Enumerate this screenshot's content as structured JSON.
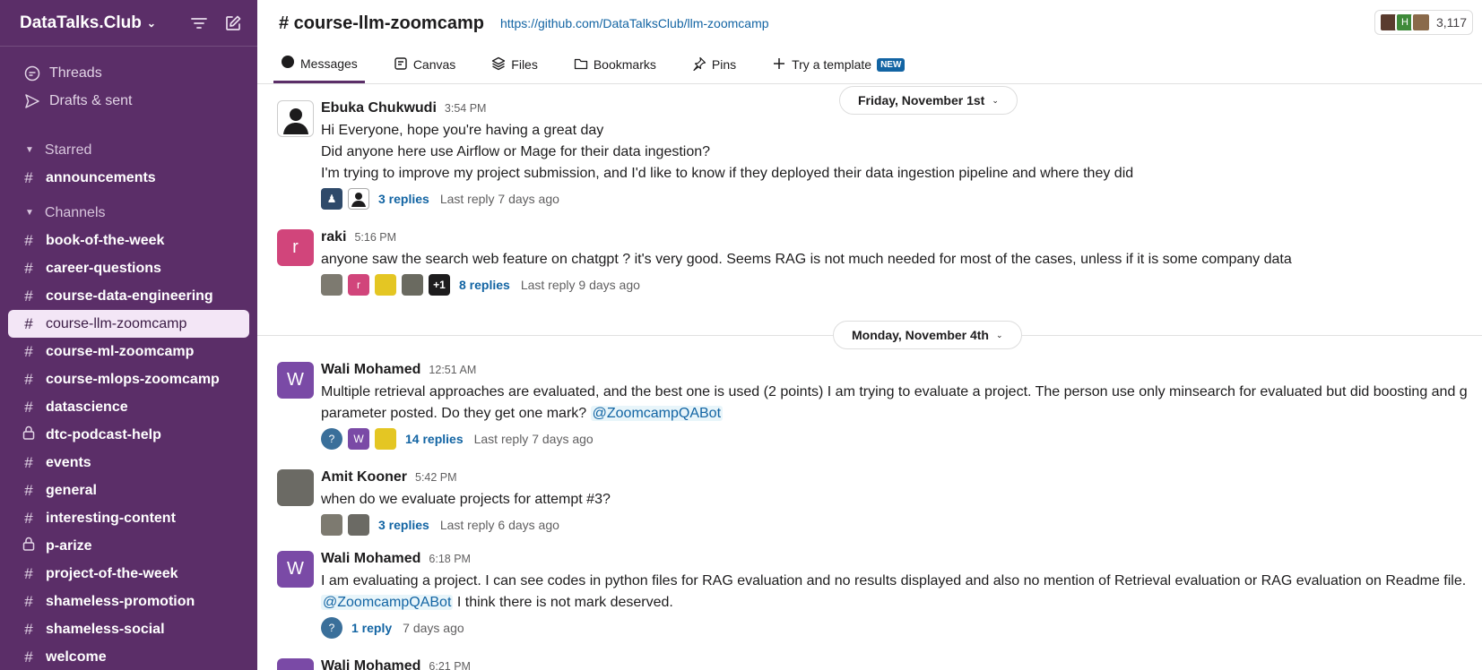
{
  "workspace": {
    "name": "DataTalks.Club"
  },
  "nav": [
    {
      "label": "Threads",
      "icon": "threads-icon"
    },
    {
      "label": "Drafts & sent",
      "icon": "send-icon"
    }
  ],
  "starred": {
    "header": "Starred",
    "channels": [
      "announcements"
    ]
  },
  "channels": {
    "header": "Channels",
    "items": [
      {
        "name": "book-of-the-week",
        "private": false
      },
      {
        "name": "career-questions",
        "private": false
      },
      {
        "name": "course-data-engineering",
        "private": false
      },
      {
        "name": "course-llm-zoomcamp",
        "private": false,
        "active": true
      },
      {
        "name": "course-ml-zoomcamp",
        "private": false
      },
      {
        "name": "course-mlops-zoomcamp",
        "private": false
      },
      {
        "name": "datascience",
        "private": false
      },
      {
        "name": "dtc-podcast-help",
        "private": true
      },
      {
        "name": "events",
        "private": false
      },
      {
        "name": "general",
        "private": false
      },
      {
        "name": "interesting-content",
        "private": false
      },
      {
        "name": "p-arize",
        "private": true
      },
      {
        "name": "project-of-the-week",
        "private": false
      },
      {
        "name": "shameless-promotion",
        "private": false
      },
      {
        "name": "shameless-social",
        "private": false
      },
      {
        "name": "welcome",
        "private": false
      }
    ]
  },
  "header": {
    "title": "# course-llm-zoomcamp",
    "topic": "https://github.com/DataTalksClub/llm-zoomcamp",
    "member_count": "3,117"
  },
  "tabs": [
    {
      "label": "Messages",
      "icon": "message-icon"
    },
    {
      "label": "Canvas",
      "icon": "canvas-icon"
    },
    {
      "label": "Files",
      "icon": "files-icon"
    },
    {
      "label": "Bookmarks",
      "icon": "bookmark-icon"
    },
    {
      "label": "Pins",
      "icon": "pin-icon"
    },
    {
      "label": "Try a template",
      "icon": "plus-icon",
      "badge": "NEW"
    }
  ],
  "dates": [
    "Friday, November 1st",
    "Monday, November 4th"
  ],
  "messages": [
    {
      "author": "Ebuka Chukwudi",
      "time": "3:54 PM",
      "lines": [
        "Hi Everyone, hope you're having a great day",
        "Did anyone here use Airflow or Mage for their data ingestion?",
        "I'm trying to improve my project submission, and I'd like to know if they deployed their data ingestion pipeline and where they did"
      ],
      "replies": "3 replies",
      "last_reply": "Last reply 7 days ago"
    },
    {
      "author": "raki",
      "time": "5:16 PM",
      "lines": [
        "anyone saw the search web feature on chatgpt ? it's very good. Seems RAG is not much needed for most of the cases, unless if it is some company data"
      ],
      "avatar_letter": "r",
      "plus_count": "+1",
      "replies": "8 replies",
      "last_reply": "Last reply 9 days ago"
    },
    {
      "author": "Wali Mohamed",
      "time": "12:51 AM",
      "lines": [
        "Multiple retrieval approaches are evaluated, and the best one is used (2 points)  I am trying to evaluate a project. The person use only minsearch for evaluated but did boosting and g",
        "parameter posted. Do they get one mark?"
      ],
      "mention": "@ZoomcampQABot",
      "avatar_letter": "W",
      "replies": "14 replies",
      "last_reply": "Last reply 7 days ago"
    },
    {
      "author": "Amit Kooner",
      "time": "5:42 PM",
      "lines": [
        "when do we evaluate projects for attempt #3?"
      ],
      "replies": "3 replies",
      "last_reply": "Last reply 6 days ago"
    },
    {
      "author": "Wali Mohamed",
      "time": "6:18 PM",
      "lines": [
        "I am evaluating a project. I can see codes in python files for RAG evaluation and no results displayed and also no mention of Retrieval evaluation or RAG evaluation on Readme file.",
        " I think there is not mark deserved."
      ],
      "mention": "@ZoomcampQABot",
      "avatar_letter": "W",
      "replies": "1 reply",
      "last_reply": "7 days ago"
    },
    {
      "author": "Wali Mohamed",
      "time": "6:21 PM"
    }
  ],
  "colors": {
    "sidebar": "#5b2e68",
    "link": "#1264a3",
    "accent_pink": "#d1457b",
    "accent_purple": "#7a4aa6"
  }
}
